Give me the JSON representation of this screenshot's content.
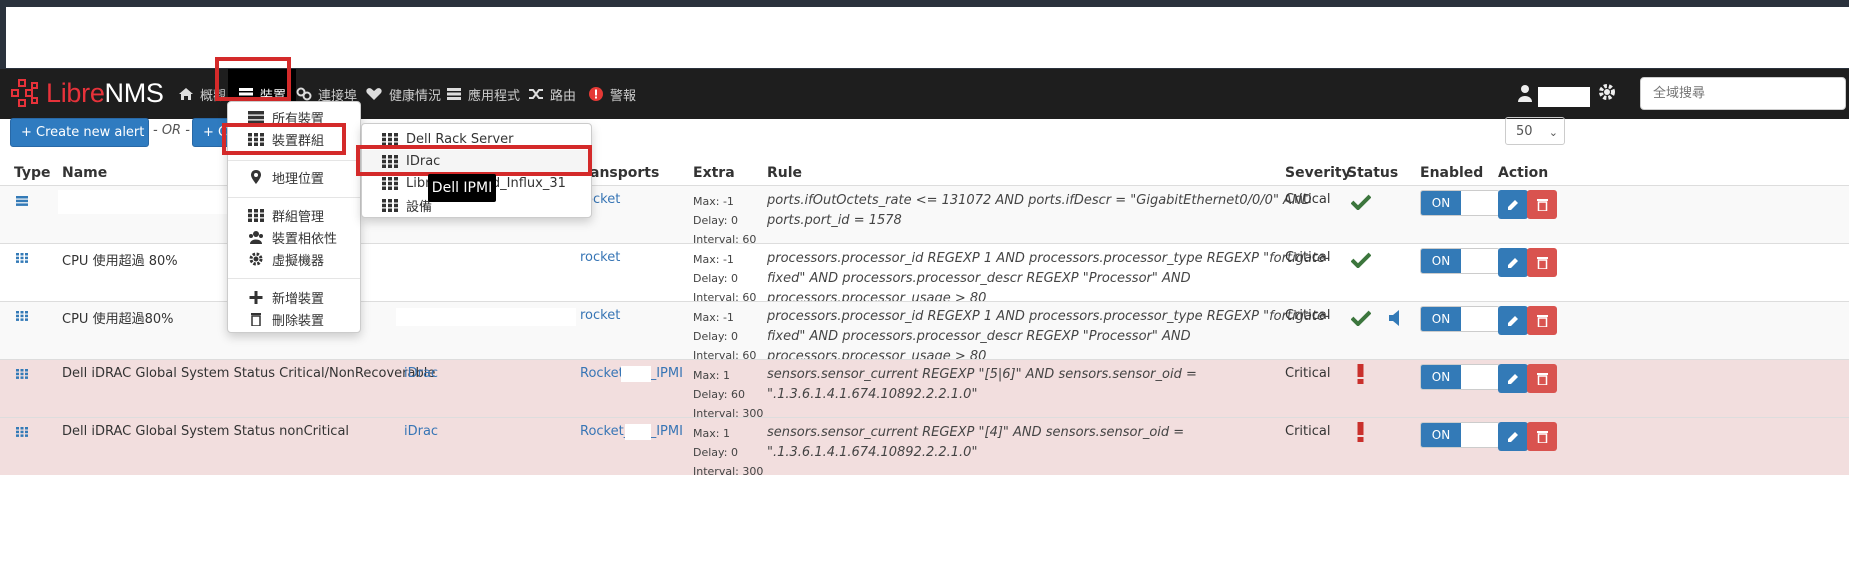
{
  "app": {
    "logo_libre": "Libre",
    "logo_nms": "NMS"
  },
  "nav": {
    "items": [
      {
        "label": "概觀",
        "icon": "home-icon"
      },
      {
        "label": "裝置",
        "icon": "server-icon"
      },
      {
        "label": "連接埠",
        "icon": "link-icon"
      },
      {
        "label": "健康情況",
        "icon": "heartbeat-icon"
      },
      {
        "label": "應用程式",
        "icon": "tasks-icon"
      },
      {
        "label": "路由",
        "icon": "random-icon"
      },
      {
        "label": "警報",
        "icon": "exclamation-circle-icon"
      }
    ],
    "search_placeholder": "全域搜尋"
  },
  "toolbar": {
    "create_alert_rule": "+ Create new alert rule",
    "or": "- OR -",
    "create_from_collection": "+ Cr",
    "per_page": "50"
  },
  "devices_menu": {
    "items": [
      {
        "label": "所有裝置",
        "icon": "server-icon"
      },
      {
        "label": "裝置群組",
        "icon": "th-icon"
      },
      {
        "label": "地理位置",
        "icon": "map-marker-icon"
      },
      {
        "label": "群組管理",
        "icon": "th-icon"
      },
      {
        "label": "裝置相依性",
        "icon": "users-icon"
      },
      {
        "label": "虛擬機器",
        "icon": "cog-icon"
      },
      {
        "label": "新增裝置",
        "icon": "plus-icon"
      },
      {
        "label": "刪除裝置",
        "icon": "trash-icon"
      }
    ]
  },
  "groups_menu": {
    "items": [
      {
        "label": "Dell Rack Server"
      },
      {
        "label": "IDrac"
      },
      {
        "label": "Libre_______nd_Influx_31"
      },
      {
        "label": "設備"
      }
    ],
    "tooltip": "Dell IPMI"
  },
  "table": {
    "headers": [
      "Type",
      "Name",
      "Transports",
      "Extra",
      "Rule",
      "Severity",
      "Status",
      "Enabled",
      "Action"
    ],
    "transports_header_visible": "ansports",
    "rows": [
      {
        "name": "",
        "devices": "",
        "transport": "rocket",
        "extra": [
          "Max: -1",
          "Delay: 0",
          "Interval: 60"
        ],
        "rule": "ports.ifOutOctets_rate <= 131072 AND ports.ifDescr = \"GigabitEthernet0/0/0\" AND ports.port_id = 1578",
        "severity": "Critical",
        "status": "ok",
        "enabled": "ON"
      },
      {
        "name": "CPU 使用超過 80%",
        "devices": "",
        "transport": "rocket",
        "extra": [
          "Max: -1",
          "Delay: 0",
          "Interval: 60"
        ],
        "rule": "processors.processor_id REGEXP 1 AND processors.processor_type REGEXP \"fortigate-fixed\" AND processors.processor_descr REGEXP \"Processor\" AND processors.processor_usage > 80",
        "severity": "Critical",
        "status": "ok",
        "enabled": "ON"
      },
      {
        "name": "CPU 使用超過80%",
        "devices": "",
        "transport": "rocket",
        "extra": [
          "Max: -1",
          "Delay: 0",
          "Interval: 60"
        ],
        "rule": "processors.processor_id REGEXP 1 AND processors.processor_type REGEXP \"fortigate-fixed\" AND processors.processor_descr REGEXP \"Processor\" AND processors.processor_usage > 80",
        "severity": "Critical",
        "status": "ok-muted",
        "enabled": "ON"
      },
      {
        "name": "Dell iDRAC Global System Status Critical/NonRecoverable",
        "devices": "iDrac",
        "transport": "Rocket_____IPMI",
        "extra": [
          "Max: 1",
          "Delay: 60",
          "Interval: 300"
        ],
        "rule": "sensors.sensor_current REGEXP \"[5|6]\" AND sensors.sensor_oid = \".1.3.6.1.4.1.674.10892.2.2.1.0\"",
        "severity": "Critical",
        "status": "alert",
        "enabled": "ON"
      },
      {
        "name": "Dell iDRAC Global System Status nonCritical",
        "devices": "iDrac",
        "transport": "Rocket_____IPMI",
        "extra": [
          "Max: 1",
          "Delay: 0",
          "Interval: 300"
        ],
        "rule": "sensors.sensor_current REGEXP \"[4]\" AND sensors.sensor_oid = \".1.3.6.1.4.1.674.10892.2.2.1.0\"",
        "severity": "Critical",
        "status": "alert",
        "enabled": "ON"
      }
    ]
  },
  "colors": {
    "navbar": "#1e1e1e",
    "primary": "#337ab7",
    "danger": "#d9534f",
    "success": "#3c763d",
    "highlight": "#d42a2a"
  }
}
